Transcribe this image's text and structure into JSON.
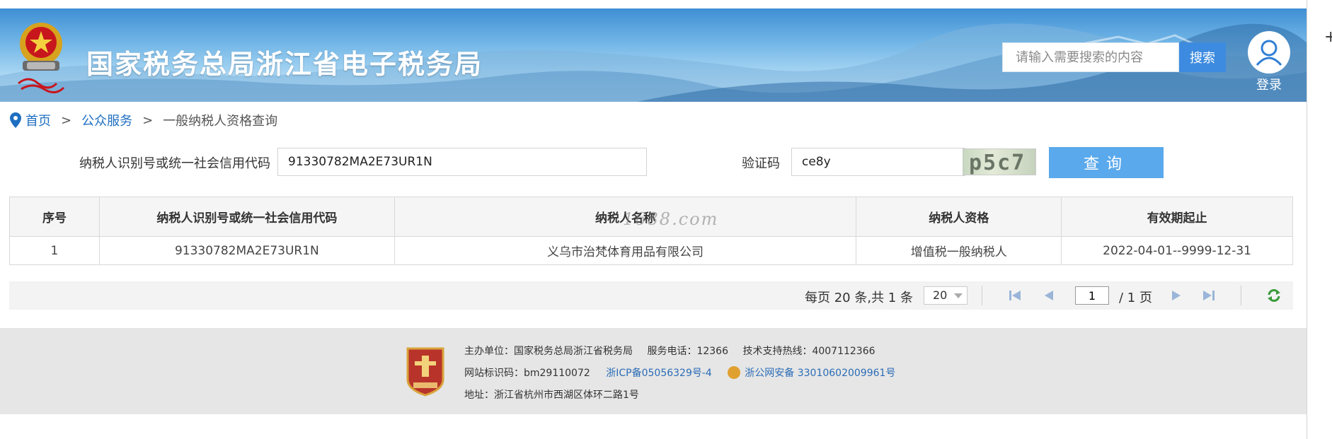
{
  "header": {
    "site_title": "国家税务总局浙江省电子税务局",
    "search_placeholder": "请输入需要搜索的内容",
    "search_button": "搜索",
    "login_label": "登录"
  },
  "breadcrumb": {
    "items": [
      "首页",
      "公众服务",
      "一般纳税人资格查询"
    ],
    "separator": ">"
  },
  "form": {
    "taxid_label": "纳税人识别号或统一社会信用代码",
    "taxid_value": "91330782MA2E73UR1N",
    "captcha_label": "验证码",
    "captcha_value": "ce8y",
    "captcha_image_text": "p5c7",
    "query_button": "查询"
  },
  "table": {
    "headers": [
      "序号",
      "纳税人识别号或统一社会信用代码",
      "纳税人名称",
      "纳税人资格",
      "有效期起止"
    ],
    "rows": [
      [
        "1",
        "91330782MA2E73UR1N",
        "义乌市治梵体育用品有限公司",
        "增值税一般纳税人",
        "2022-04-01--9999-12-31"
      ]
    ],
    "watermark": "1688.com"
  },
  "pager": {
    "info": "每页 20 条,共 1 条",
    "page_size": "20",
    "current_page": "1",
    "total_pages": "/ 1 页"
  },
  "footer": {
    "host": "主办单位：国家税务总局浙江省税务局",
    "phone": "服务电话：12366",
    "support": "技术支持热线：4007112366",
    "site_code": "网站标识码：bm29110072",
    "icp": "浙ICP备05056329号-4",
    "police_record": "浙公网安备 33010602009961号",
    "address": "地址：浙江省杭州市西湖区体环二路1号"
  },
  "colors": {
    "brand_blue": "#1f6fc1",
    "query_button": "#5aa9ec",
    "search_button": "#3d8be0"
  }
}
